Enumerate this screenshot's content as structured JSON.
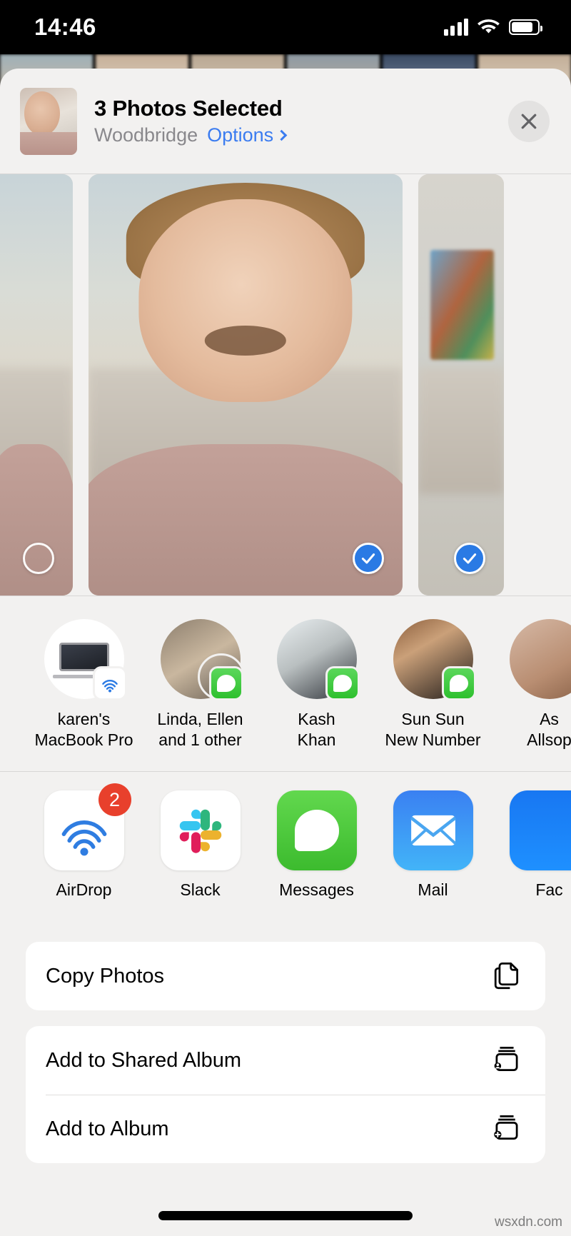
{
  "status_bar": {
    "time": "14:46",
    "signal_icon": "cellular-signal-icon",
    "wifi_icon": "wifi-icon",
    "battery_icon": "battery-icon"
  },
  "share_sheet": {
    "header": {
      "thumbnail_name": "selected-photo-thumbnail",
      "title": "3 Photos Selected",
      "location": "Woodbridge",
      "options_label": "Options",
      "close_icon": "close-icon"
    },
    "photo_strip": {
      "photos": [
        {
          "name": "photo-partial-left",
          "selected": false,
          "selector_icon": "empty-circle-icon"
        },
        {
          "name": "photo-child-portrait",
          "selected": true,
          "selector_icon": "checkmark-circle-icon"
        },
        {
          "name": "photo-living-room",
          "selected": true,
          "selector_icon": "checkmark-circle-icon"
        }
      ]
    },
    "contacts": [
      {
        "name": "karen's\nMacBook Pro",
        "line1": "karen's",
        "line2": "MacBook Pro",
        "badge": "airdrop-badge-icon",
        "avatar": "macbook-pro-icon"
      },
      {
        "name": "Linda, Ellen and 1 other",
        "line1": "Linda, Ellen",
        "line2": "and 1 other",
        "badge": "messages-badge-icon",
        "avatar": "group-avatar"
      },
      {
        "name": "Kash Khan",
        "line1": "Kash",
        "line2": "Khan",
        "badge": "messages-badge-icon",
        "avatar": "contact-avatar"
      },
      {
        "name": "Sun Sun New Number",
        "line1": "Sun Sun",
        "line2": "New Number",
        "badge": "messages-badge-icon",
        "avatar": "contact-avatar"
      },
      {
        "name": "As Allsop",
        "line1": "As",
        "line2": "Allsop",
        "badge": "",
        "avatar": "contact-avatar"
      }
    ],
    "apps": [
      {
        "label": "AirDrop",
        "icon": "airdrop-icon",
        "badge": "2"
      },
      {
        "label": "Slack",
        "icon": "slack-icon",
        "badge": ""
      },
      {
        "label": "Messages",
        "icon": "messages-icon",
        "badge": ""
      },
      {
        "label": "Mail",
        "icon": "mail-icon",
        "badge": ""
      },
      {
        "label": "Fac",
        "icon": "facebook-icon",
        "badge": ""
      }
    ],
    "action_groups": [
      {
        "rows": [
          {
            "label": "Copy Photos",
            "icon": "copy-icon"
          }
        ]
      },
      {
        "rows": [
          {
            "label": "Add to Shared Album",
            "icon": "shared-album-icon"
          },
          {
            "label": "Add to Album",
            "icon": "add-album-icon"
          }
        ]
      }
    ]
  },
  "watermark": "wsxdn.com",
  "colors": {
    "accent_blue": "#3b7cf0",
    "selected_blue": "#2a7ae4",
    "badge_red": "#e8402c",
    "messages_green": "#3cbb2e",
    "sheet_bg": "#f2f1f0",
    "card_bg": "#ffffff",
    "secondary_text": "#89888c"
  }
}
